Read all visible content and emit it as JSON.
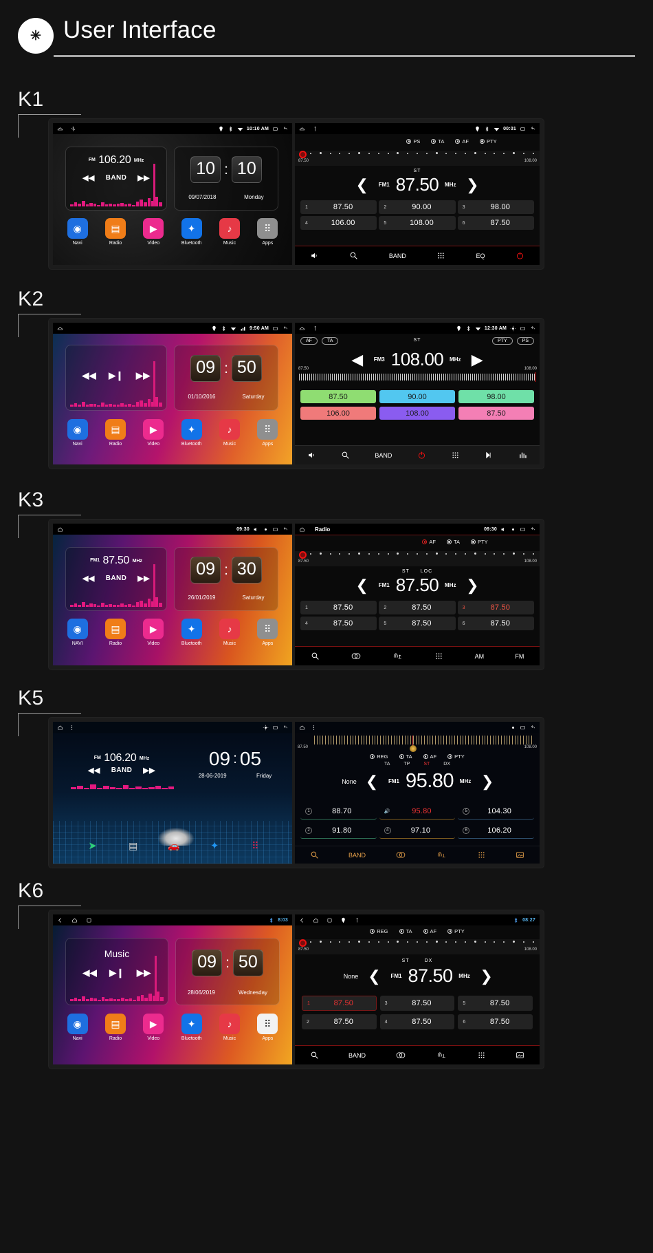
{
  "header": {
    "badge": "✳",
    "title": "User Interface"
  },
  "sections": [
    {
      "label": "K1",
      "home": {
        "status": {
          "time": "10:10 AM",
          "icons": [
            "home-icon",
            "usb-icon",
            "location-icon",
            "bluetooth-icon",
            "wifi-icon",
            "recents-icon",
            "back-icon"
          ]
        },
        "radio_widget": {
          "band_prefix": "FM",
          "frequency": "106.20",
          "unit": "MHz",
          "band_label": "BAND",
          "prev": "◀◀",
          "next": "▶▶"
        },
        "clock_widget": {
          "hour": "10",
          "colon": ":",
          "minute": "10",
          "date": "09/07/2018",
          "weekday": "Monday"
        },
        "dock": [
          {
            "label": "Navi",
            "icon": "navi-icon",
            "color": "#1e6fe0"
          },
          {
            "label": "Radio",
            "icon": "radio-icon",
            "color": "#f07d18"
          },
          {
            "label": "Video",
            "icon": "video-icon",
            "color": "#ec2b8e"
          },
          {
            "label": "Bluetooth",
            "icon": "bluetooth-icon",
            "color": "#1273e8"
          },
          {
            "label": "Music",
            "icon": "music-icon",
            "color": "#e63946"
          },
          {
            "label": "Apps",
            "icon": "apps-icon",
            "color": "#8f8f8f"
          }
        ]
      },
      "radio": {
        "status": {
          "time": "00:01"
        },
        "rds": [
          "PS",
          "TA",
          "AF",
          "PTY"
        ],
        "dial": {
          "min": "87.50",
          "max": "108.00"
        },
        "tuner": {
          "st": "ST",
          "band": "FM1",
          "frequency": "87.50",
          "unit": "MHz",
          "prev": "❮",
          "next": "❯"
        },
        "presets": [
          {
            "n": "1",
            "v": "87.50"
          },
          {
            "n": "2",
            "v": "90.00"
          },
          {
            "n": "3",
            "v": "98.00"
          },
          {
            "n": "4",
            "v": "106.00"
          },
          {
            "n": "5",
            "v": "108.00"
          },
          {
            "n": "6",
            "v": "87.50"
          }
        ],
        "toolbar": [
          "volume-icon",
          "search-icon",
          "BAND",
          "keypad-icon",
          "EQ",
          "power-icon"
        ]
      }
    },
    {
      "label": "K2",
      "home": {
        "status": {
          "time": "9:50 AM"
        },
        "radio_widget": {
          "prev": "◀◀",
          "play": "▶❙",
          "next": "▶▶"
        },
        "clock_widget": {
          "hour": "09",
          "colon": ":",
          "minute": "50",
          "date": "01/10/2016",
          "weekday": "Saturday"
        },
        "dock": [
          {
            "label": "Navi",
            "icon": "navi-icon",
            "color": "#1e6fe0"
          },
          {
            "label": "Radio",
            "icon": "radio-icon",
            "color": "#f07d18"
          },
          {
            "label": "Video",
            "icon": "video-icon",
            "color": "#ec2b8e"
          },
          {
            "label": "Bluetooth",
            "icon": "bluetooth-icon",
            "color": "#1273e8"
          },
          {
            "label": "Music",
            "icon": "music-icon",
            "color": "#e63946"
          },
          {
            "label": "Apps",
            "icon": "apps-icon",
            "color": "#8f8f8f"
          }
        ]
      },
      "radio": {
        "status": {
          "time": "12:30 AM"
        },
        "chips_left": [
          "AF",
          "TA"
        ],
        "chips_right": [
          "PTY",
          "PS"
        ],
        "tuner": {
          "st": "ST",
          "band": "FM3",
          "frequency": "108.00",
          "unit": "MHz",
          "prev": "◀",
          "next": "▶"
        },
        "dial": {
          "min": "87.50",
          "max": "108.00"
        },
        "presets": [
          {
            "v": "87.50",
            "color": "#8fdd72"
          },
          {
            "v": "90.00",
            "color": "#52c7f0"
          },
          {
            "v": "98.00",
            "color": "#6fe0a8"
          },
          {
            "v": "106.00",
            "color": "#f07a7a"
          },
          {
            "v": "108.00",
            "color": "#8a5cf0"
          },
          {
            "v": "87.50",
            "color": "#f47fb5"
          }
        ],
        "toolbar": [
          "volume-icon",
          "search-icon",
          "BAND",
          "power-icon",
          "keypad-icon",
          "next-track-icon",
          "eq-icon"
        ]
      }
    },
    {
      "label": "K3",
      "home": {
        "status": {
          "time": "09:30"
        },
        "radio_widget": {
          "band_prefix": "FM1",
          "frequency": "87.50",
          "unit": "MHz",
          "band_label": "BAND",
          "prev": "◀◀",
          "next": "▶▶"
        },
        "clock_widget": {
          "hour": "09",
          "colon": ":",
          "minute": "30",
          "date": "26/01/2019",
          "weekday": "Saturday"
        },
        "dock": [
          {
            "label": "NAVI",
            "icon": "navi-icon",
            "color": "#1e6fe0"
          },
          {
            "label": "Radio",
            "icon": "radio-icon",
            "color": "#f07d18"
          },
          {
            "label": "Video",
            "icon": "video-icon",
            "color": "#ec2b8e"
          },
          {
            "label": "Bluetooth",
            "icon": "bluetooth-icon",
            "color": "#1273e8"
          },
          {
            "label": "Music",
            "icon": "music-icon",
            "color": "#e63946"
          },
          {
            "label": "Apps",
            "icon": "apps-icon",
            "color": "#8f8f8f"
          }
        ]
      },
      "radio": {
        "title": "Radio",
        "status": {
          "time": "09:30"
        },
        "rds": [
          "AF",
          "TA",
          "PTY"
        ],
        "dial": {
          "min": "87.50",
          "max": "108.00"
        },
        "tuner": {
          "st": "ST",
          "loc": "LOC",
          "band": "FM1",
          "frequency": "87.50",
          "unit": "MHz",
          "prev": "❮",
          "next": "❯"
        },
        "presets": [
          {
            "n": "1",
            "v": "87.50",
            "active": false
          },
          {
            "n": "2",
            "v": "87.50",
            "active": false
          },
          {
            "n": "3",
            "v": "87.50",
            "active": true
          },
          {
            "n": "4",
            "v": "87.50",
            "active": false
          },
          {
            "n": "5",
            "v": "87.50",
            "active": false
          },
          {
            "n": "6",
            "v": "87.50",
            "active": false
          }
        ],
        "toolbar": [
          "search-icon",
          "stereo-icon",
          "loc-dx-icon",
          "keypad-icon",
          "AM",
          "FM"
        ]
      }
    },
    {
      "label": "K5",
      "home": {
        "status": {
          "time": ""
        },
        "radio_widget": {
          "band_prefix": "FM",
          "frequency": "106.20",
          "unit": "MHz",
          "band_label": "BAND",
          "prev": "◀◀",
          "next": "▶▶"
        },
        "clock_widget": {
          "hour": "09",
          "colon": ":",
          "minute": "05",
          "date": "28-06-2019",
          "weekday": "Friday"
        },
        "dock": [
          {
            "label": "",
            "icon": "navi-icon",
            "color": "#2ecf7a"
          },
          {
            "label": "",
            "icon": "radio-icon",
            "color": "#bfbfbf"
          },
          {
            "label": "",
            "icon": "car-icon",
            "color": "#e8b23a"
          },
          {
            "label": "",
            "icon": "bluetooth-icon",
            "color": "#2196f3"
          },
          {
            "label": "",
            "icon": "apps-icon",
            "color": "#e0234e"
          }
        ]
      },
      "radio": {
        "status": {
          "time": ""
        },
        "dial": {
          "min": "87.50",
          "max": "108.00"
        },
        "rds": [
          "REG",
          "TA",
          "AF",
          "PTY"
        ],
        "flags": [
          "TA",
          "TP",
          "ST",
          "DX"
        ],
        "tuner": {
          "none": "None",
          "band": "FM1",
          "frequency": "95.80",
          "unit": "MHz",
          "prev": "❮",
          "next": "❯"
        },
        "presets": [
          {
            "n": "1",
            "v": "88.70",
            "active": false
          },
          {
            "n": "3",
            "v": "95.80",
            "active": true
          },
          {
            "n": "5",
            "v": "104.30",
            "active": false
          },
          {
            "n": "2",
            "v": "91.80",
            "active": false
          },
          {
            "n": "4",
            "v": "97.10",
            "active": false
          },
          {
            "n": "6",
            "v": "106.20",
            "active": false
          }
        ],
        "toolbar": [
          "search-icon",
          "BAND",
          "stereo-icon",
          "loc-dx-icon",
          "keypad-icon",
          "image-icon"
        ]
      }
    },
    {
      "label": "K6",
      "home": {
        "status": {
          "time": "8:03"
        },
        "radio_widget": {
          "title": "Music",
          "prev": "◀◀",
          "play": "▶❙",
          "next": "▶▶"
        },
        "clock_widget": {
          "hour": "09",
          "colon": ":",
          "minute": "50",
          "date": "28/06/2019",
          "weekday": "Wednesday"
        },
        "dock": [
          {
            "label": "Navi",
            "icon": "navi-icon",
            "color": "#1e6fe0"
          },
          {
            "label": "Radio",
            "icon": "radio-icon",
            "color": "#f07d18"
          },
          {
            "label": "Video",
            "icon": "video-icon",
            "color": "#ec2b8e"
          },
          {
            "label": "Bluetooth",
            "icon": "bluetooth-icon",
            "color": "#1273e8"
          },
          {
            "label": "Music",
            "icon": "music-icon",
            "color": "#e63946"
          },
          {
            "label": "Apps",
            "icon": "apps-icon",
            "color": "#f2f2f2"
          }
        ]
      },
      "radio": {
        "status": {
          "time": "08:27"
        },
        "rds": [
          "REG",
          "TA",
          "AF",
          "PTY"
        ],
        "dial": {
          "min": "87.50",
          "max": "108.00"
        },
        "tuner": {
          "none": "None",
          "st": "ST",
          "dx": "DX",
          "band": "FM1",
          "frequency": "87.50",
          "unit": "MHz",
          "prev": "❮",
          "next": "❯"
        },
        "presets": [
          {
            "n": "1",
            "v": "87.50",
            "active": true
          },
          {
            "n": "3",
            "v": "87.50",
            "active": false
          },
          {
            "n": "5",
            "v": "87.50",
            "active": false
          },
          {
            "n": "2",
            "v": "87.50",
            "active": false
          },
          {
            "n": "4",
            "v": "87.50",
            "active": false
          },
          {
            "n": "6",
            "v": "87.50",
            "active": false
          }
        ],
        "toolbar": [
          "search-icon",
          "BAND",
          "stereo-icon",
          "loc-dx-icon",
          "keypad-icon",
          "image-icon"
        ]
      }
    }
  ]
}
